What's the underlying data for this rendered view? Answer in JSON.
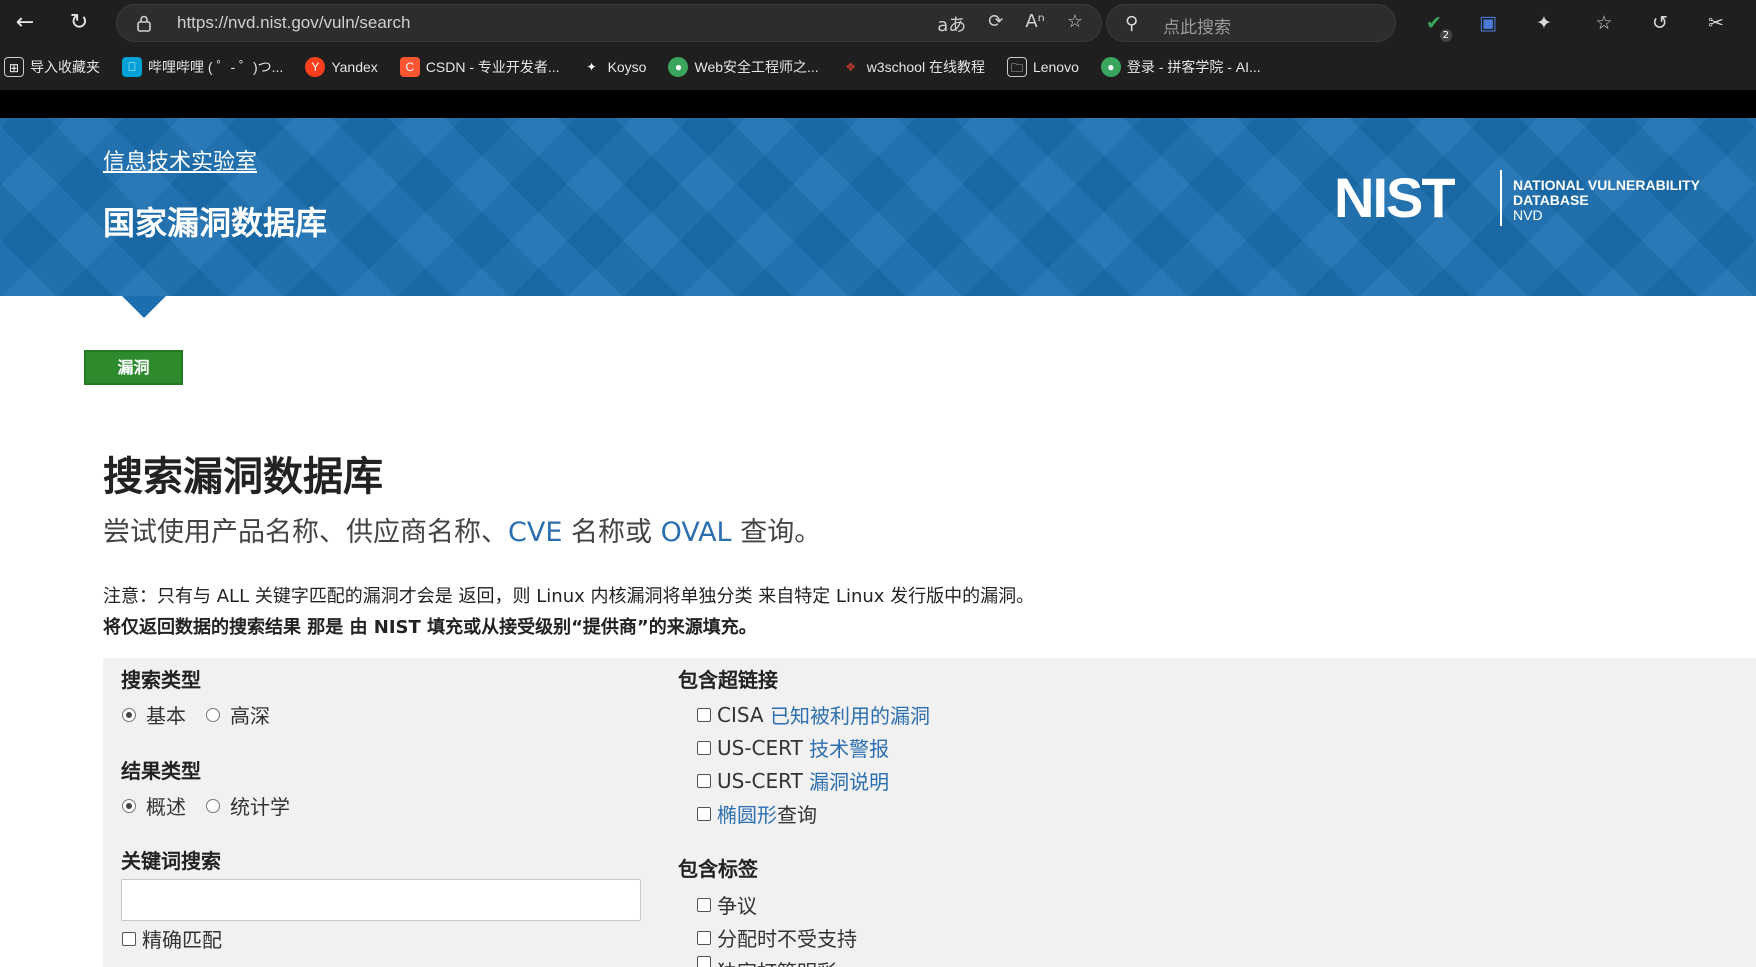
{
  "browser": {
    "url": "https://nvd.nist.gov/vuln/search",
    "search_placeholder": "点此搜索",
    "ext_badge": "2",
    "bookmarks": [
      {
        "label": "导入收藏夹",
        "icon": "import-icon",
        "color": "#1f1f1f"
      },
      {
        "label": "哔哩哔哩 ( ゜- ゜)つ...",
        "icon": "bilibili-icon",
        "color": "#00a1d6"
      },
      {
        "label": "Yandex",
        "icon": "yandex-icon",
        "color": "#fc3f1d"
      },
      {
        "label": "CSDN - 专业开发者...",
        "icon": "csdn-icon",
        "color": "#fc5531"
      },
      {
        "label": "Koyso",
        "icon": "sparkle-icon",
        "color": "#1f1f1f"
      },
      {
        "label": "Web安全工程师之...",
        "icon": "web-icon",
        "color": "#3aa55d"
      },
      {
        "label": "w3school 在线教程",
        "icon": "w3school-icon",
        "color": "#c0392b"
      },
      {
        "label": "Lenovo",
        "icon": "folder-icon",
        "color": "#1f1f1f"
      },
      {
        "label": "登录 - 拼客学院 - AI...",
        "icon": "pinke-icon",
        "color": "#3aa55d"
      }
    ]
  },
  "header": {
    "org": "信息技术实验室",
    "db_name": "国家漏洞数据库",
    "logo_nist": "NIST",
    "logo_line1": "NATIONAL VULNERABILITY",
    "logo_line2": "DATABASE",
    "logo_line3": "NVD",
    "brand_color": "#1b6fb0"
  },
  "tab": {
    "label": "漏洞",
    "color": "#2d8a2d"
  },
  "main": {
    "title": "搜索漏洞数据库",
    "lead_prefix": "尝试使用产品名称、供应商名称、",
    "lead_cve": "CVE",
    "lead_mid": " 名称或 ",
    "lead_oval": "OVAL",
    "lead_suffix": " 查询。",
    "note_line1": "注意：只有与 ALL 关键字匹配的漏洞才会是 返回，则 Linux 内核漏洞将单独分类 来自特定 Linux 发行版中的漏洞。",
    "note_line2": "将仅返回数据的搜索结果 那是 由 NIST 填充或从接受级别“提供商”的来源填充。"
  },
  "form": {
    "search_type_label": "搜索类型",
    "search_type_options": [
      "基本",
      "高深"
    ],
    "search_type_selected": "基本",
    "result_type_label": "结果类型",
    "result_type_options": [
      "概述",
      "统计学"
    ],
    "result_type_selected": "概述",
    "keyword_label": "关键词搜索",
    "keyword_value": "",
    "exact_match_label": "精确匹配",
    "hyperlinks_label": "包含超链接",
    "hyperlinks": [
      {
        "prefix": "CISA ",
        "link": "已知被利用的漏洞",
        "suffix": ""
      },
      {
        "prefix": "US-CERT ",
        "link": "技术警报",
        "suffix": ""
      },
      {
        "prefix": "US-CERT ",
        "link": "漏洞说明",
        "suffix": ""
      },
      {
        "prefix": "",
        "link": "椭圆形",
        "suffix": "查询"
      }
    ],
    "tags_label": "包含标签",
    "tags": [
      "争议",
      "分配时不受支持",
      "独家打篮明彩"
    ]
  }
}
